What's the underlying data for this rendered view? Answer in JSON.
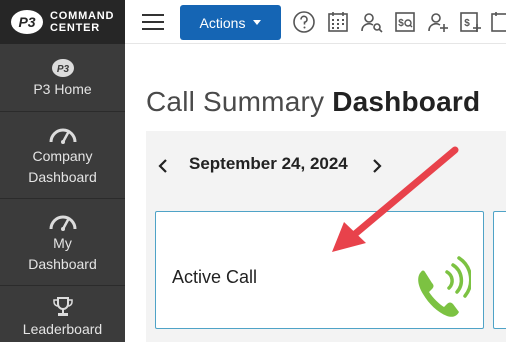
{
  "brand": {
    "logo_text": "P3",
    "line1": "COMMAND",
    "line2": "CENTER"
  },
  "sidebar": {
    "items": [
      {
        "label": "P3 Home",
        "icon": "p3-logo-icon"
      },
      {
        "label": "Company Dashboard",
        "icon": "speedometer-icon"
      },
      {
        "label": "My Dashboard",
        "icon": "speedometer-icon"
      },
      {
        "label": "Leaderboard",
        "icon": "trophy-icon"
      }
    ]
  },
  "toolbar": {
    "actions_label": "Actions",
    "icons": [
      "help-icon",
      "calendar-icon",
      "user-search-icon",
      "dollar-search-icon",
      "add-user-icon",
      "add-dollar-icon",
      "calendar-icon"
    ]
  },
  "page": {
    "title_light": "Call Summary",
    "title_bold": "Dashboard"
  },
  "date_nav": {
    "date": "September 24, 2024"
  },
  "cards": [
    {
      "label": "Active Call",
      "icon": "phone-ringing-icon"
    }
  ],
  "colors": {
    "sidebar": "#3b3b3b",
    "brand_bar": "#262626",
    "actions": "#1565b4",
    "card_border": "#4fa3c7",
    "phone": "#7cc242",
    "arrow": "#e8424b"
  }
}
